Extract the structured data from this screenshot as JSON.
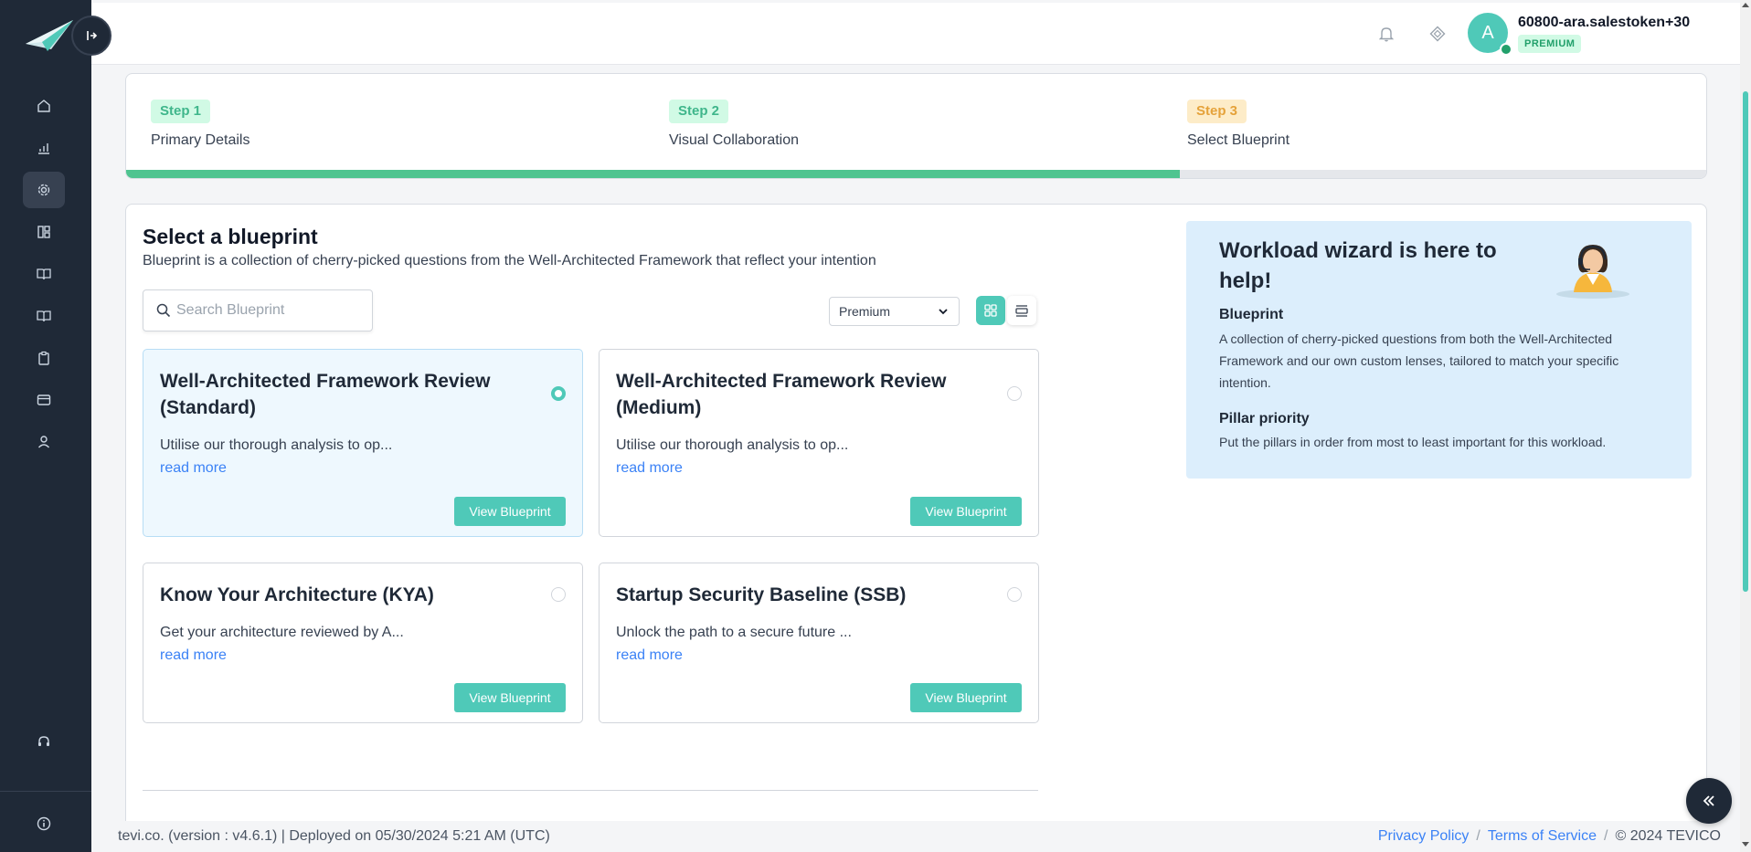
{
  "sidebar": {
    "logo_icon": "paper-plane-logo",
    "collapse_icon": "sidebar-collapse-icon",
    "items": [
      {
        "icon": "home-icon",
        "active": false
      },
      {
        "icon": "chart-icon",
        "active": false
      },
      {
        "icon": "gear-icon",
        "active": true
      },
      {
        "icon": "dashboard-icon",
        "active": false
      },
      {
        "icon": "book-icon",
        "active": false
      },
      {
        "icon": "book-open-icon",
        "active": false
      },
      {
        "icon": "clipboard-icon",
        "active": false
      },
      {
        "icon": "card-icon",
        "active": false
      },
      {
        "icon": "user-icon",
        "active": false
      }
    ],
    "support_icon": "headset-icon",
    "info_icon": "info-icon"
  },
  "header": {
    "notifications_icon": "bell-icon",
    "diamond_icon": "diamond-icon",
    "avatar_initial": "A",
    "user_name": "60800-ara.salestoken+30",
    "plan_badge": "PREMIUM"
  },
  "steps": {
    "items": [
      {
        "badge": "Step 1",
        "label": "Primary Details",
        "status": "done"
      },
      {
        "badge": "Step 2",
        "label": "Visual Collaboration",
        "status": "done"
      },
      {
        "badge": "Step 3",
        "label": "Select Blueprint",
        "status": "current"
      }
    ],
    "progress_percent": 66.7
  },
  "main": {
    "title": "Select a blueprint",
    "subtitle": "Blueprint is a collection of cherry-picked questions from the Well-Architected Framework that reflect your intention",
    "search": {
      "placeholder": "Search Blueprint",
      "value": ""
    },
    "filter": {
      "selected": "Premium"
    },
    "view_mode": "grid",
    "blueprints": [
      {
        "title": "Well-Architected Framework Review (Standard)",
        "description": "Utilise our thorough analysis to op...",
        "read_more": "read more",
        "button": "View Blueprint",
        "selected": true
      },
      {
        "title": "Well-Architected Framework Review (Medium)",
        "description": "Utilise our thorough analysis to op...",
        "read_more": "read more",
        "button": "View Blueprint",
        "selected": false
      },
      {
        "title": "Know Your Architecture (KYA)",
        "description": "Get your architecture reviewed by A...",
        "read_more": "read more",
        "button": "View Blueprint",
        "selected": false
      },
      {
        "title": "Startup Security Baseline (SSB)",
        "description": "Unlock the path to a secure future ...",
        "read_more": "read more",
        "button": "View Blueprint",
        "selected": false
      }
    ]
  },
  "help_panel": {
    "title": "Workload wizard is here to help!",
    "illustration": "support-agent-illustration",
    "sections": [
      {
        "heading": "Blueprint",
        "text": "A collection of cherry-picked questions from both the Well-Architected Framework and our own custom lenses, tailored to match your specific intention."
      },
      {
        "heading": "Pillar priority",
        "text": "Put the pillars in order from most to least important for this workload."
      }
    ]
  },
  "footer": {
    "left": "tevi.co. (version : v4.6.1) | Deployed on 05/30/2024 5:21 AM (UTC)",
    "privacy": "Privacy Policy",
    "terms": "Terms of Service",
    "copyright": "© 2024 TEVICO",
    "sep": "/"
  },
  "fab_icon": "double-chevron-left-icon",
  "colors": {
    "accent": "#4fc9b8",
    "sidebar": "#1f2937",
    "link": "#3b82f6",
    "progress": "#4fc490",
    "help_bg": "#dceefc"
  }
}
